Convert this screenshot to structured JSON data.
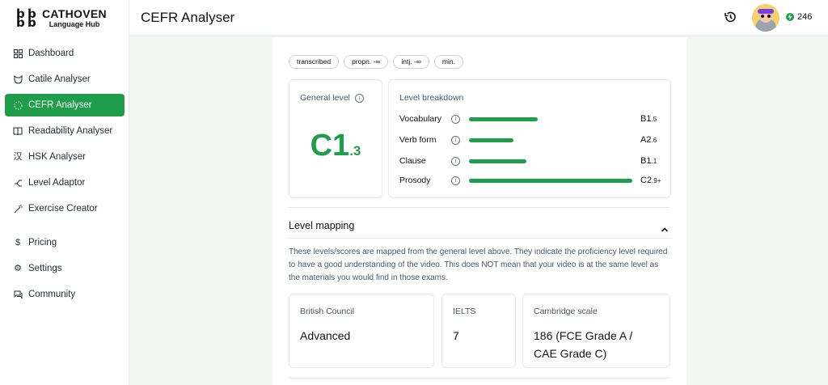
{
  "brand": {
    "mark": "b b\nb b",
    "name": "CATHOVEN",
    "sub": "Language Hub"
  },
  "nav": [
    {
      "label": "Dashboard",
      "icon": "grid-icon"
    },
    {
      "label": "Catile Analyser",
      "icon": "cat-icon"
    },
    {
      "label": "CEFR Analyser",
      "icon": "spinner-icon",
      "active": true
    },
    {
      "label": "Readability Analyser",
      "icon": "book-icon"
    },
    {
      "label": "HSK Analyser",
      "icon": "chinese-char-icon"
    },
    {
      "label": "Level Adaptor",
      "icon": "branch-icon"
    },
    {
      "label": "Exercise Creator",
      "icon": "wand-icon"
    },
    {
      "label": "Pricing",
      "icon": "dollar-icon"
    },
    {
      "label": "Settings",
      "icon": "gear-icon"
    },
    {
      "label": "Community",
      "icon": "chat-icon"
    }
  ],
  "header": {
    "title": "CEFR Analyser",
    "credits": "246"
  },
  "tags": [
    "transcribed",
    "propn. -∞",
    "intj. -∞",
    "min."
  ],
  "general": {
    "label": "General level",
    "level": "C1",
    "sub": ".3"
  },
  "breakdown": {
    "title": "Level breakdown",
    "rows": [
      {
        "name": "Vocabulary",
        "level": "B1",
        "sub": ".5",
        "fill": 0.42
      },
      {
        "name": "Verb form",
        "level": "A2",
        "sub": ".6",
        "fill": 0.27
      },
      {
        "name": "Clause",
        "level": "B1",
        "sub": ".1",
        "fill": 0.35
      },
      {
        "name": "Prosody",
        "level": "C2",
        "sub": ".9+",
        "fill": 1.0
      }
    ]
  },
  "mapping": {
    "title": "Level mapping",
    "description": "These levels/scores are mapped from the general level above. They indicate the proficiency level required to have a good understanding of the video. This does NOT mean that your video is at the same level as the materials you would find in those exams.",
    "british_council": {
      "label": "British Council",
      "value": "Advanced"
    },
    "ielts": {
      "label": "IELTS",
      "value": "7"
    },
    "cambridge": {
      "label": "Cambridge scale",
      "value": "186 (FCE Grade A / CAE Grade C)"
    }
  },
  "colors": {
    "accent": "#1f9d4a"
  }
}
